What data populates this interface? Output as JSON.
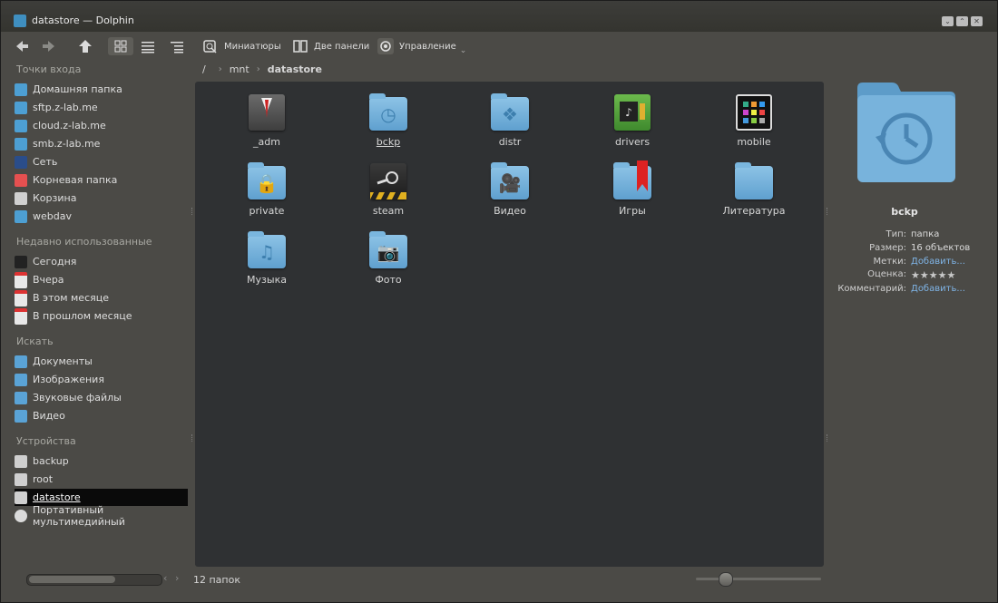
{
  "window": {
    "title": "datastore — Dolphin"
  },
  "toolbar": {
    "back_icon": "arrow-left-icon",
    "forward_icon": "arrow-right-icon",
    "up_icon": "arrow-up-icon",
    "preview_label": "Миниатюры",
    "split_label": "Две панели",
    "control_label": "Управление"
  },
  "sidebar": {
    "places_title": "Точки входа",
    "places": [
      {
        "label": "Домашняя папка",
        "icon": "home-icon",
        "color": "#4d9fd3"
      },
      {
        "label": "sftp.z-lab.me",
        "icon": "network-icon",
        "color": "#4d9fd3"
      },
      {
        "label": "cloud.z-lab.me",
        "icon": "network-icon",
        "color": "#4d9fd3"
      },
      {
        "label": "smb.z-lab.me",
        "icon": "network-icon",
        "color": "#4d9fd3"
      },
      {
        "label": "Сеть",
        "icon": "network-computers-icon",
        "color": "#2a4d8a"
      },
      {
        "label": "Корневая папка",
        "icon": "root-folder-icon",
        "color": "#e55050"
      },
      {
        "label": "Корзина",
        "icon": "trash-icon",
        "color": "#d0d0d0"
      },
      {
        "label": "webdav",
        "icon": "network-icon",
        "color": "#4d9fd3"
      }
    ],
    "recent_title": "Недавно использованные",
    "recent": [
      {
        "label": "Сегодня",
        "icon": "clock-icon"
      },
      {
        "label": "Вчера",
        "icon": "calendar-icon"
      },
      {
        "label": "В этом месяце",
        "icon": "calendar-icon"
      },
      {
        "label": "В прошлом месяце",
        "icon": "calendar-icon"
      }
    ],
    "search_title": "Искать",
    "search": [
      {
        "label": "Документы",
        "icon": "document-icon"
      },
      {
        "label": "Изображения",
        "icon": "image-icon"
      },
      {
        "label": "Звуковые файлы",
        "icon": "audio-icon"
      },
      {
        "label": "Видео",
        "icon": "video-icon"
      }
    ],
    "devices_title": "Устройства",
    "devices": [
      {
        "label": "backup",
        "icon": "drive-icon"
      },
      {
        "label": "root",
        "icon": "drive-icon"
      },
      {
        "label": "datastore",
        "icon": "drive-icon",
        "selected": true
      },
      {
        "label": "Портативный мультимедийный",
        "icon": "media-player-icon"
      }
    ]
  },
  "breadcrumb": {
    "root": "/",
    "segments": [
      "mnt",
      "datastore"
    ]
  },
  "items": [
    {
      "label": "_adm",
      "icon": "suit-icon",
      "kind": "app"
    },
    {
      "label": "bckp",
      "icon": "backup-folder-icon",
      "kind": "folder",
      "glyph": "◷",
      "underlined": true
    },
    {
      "label": "distr",
      "icon": "dropbox-folder-icon",
      "kind": "folder",
      "glyph": "❖"
    },
    {
      "label": "drivers",
      "icon": "chip-icon",
      "kind": "app"
    },
    {
      "label": "mobile",
      "icon": "phone-icon",
      "kind": "app"
    },
    {
      "label": "private",
      "icon": "lock-folder-icon",
      "kind": "folder",
      "glyph": "🔒"
    },
    {
      "label": "steam",
      "icon": "steam-icon",
      "kind": "app"
    },
    {
      "label": "Видео",
      "icon": "video-folder-icon",
      "kind": "folder",
      "glyph": "🎥"
    },
    {
      "label": "Игры",
      "icon": "bookmark-folder-icon",
      "kind": "folder",
      "glyph": ""
    },
    {
      "label": "Литература",
      "icon": "folder-icon",
      "kind": "folder",
      "glyph": ""
    },
    {
      "label": "Музыка",
      "icon": "music-folder-icon",
      "kind": "folder",
      "glyph": "♫"
    },
    {
      "label": "Фото",
      "icon": "camera-folder-icon",
      "kind": "folder",
      "glyph": "📷"
    }
  ],
  "status": {
    "count": "12 папок",
    "zoom_fraction": 0.2
  },
  "info": {
    "name": "bckp",
    "type_key": "Тип:",
    "type_val": "папка",
    "size_key": "Размер:",
    "size_val": "16 объектов",
    "tags_key": "Метки:",
    "tags_val": "Добавить...",
    "rating_key": "Оценка:",
    "rating_value": 0,
    "rating_max": 5,
    "comment_key": "Комментарий:",
    "comment_val": "Добавить..."
  }
}
